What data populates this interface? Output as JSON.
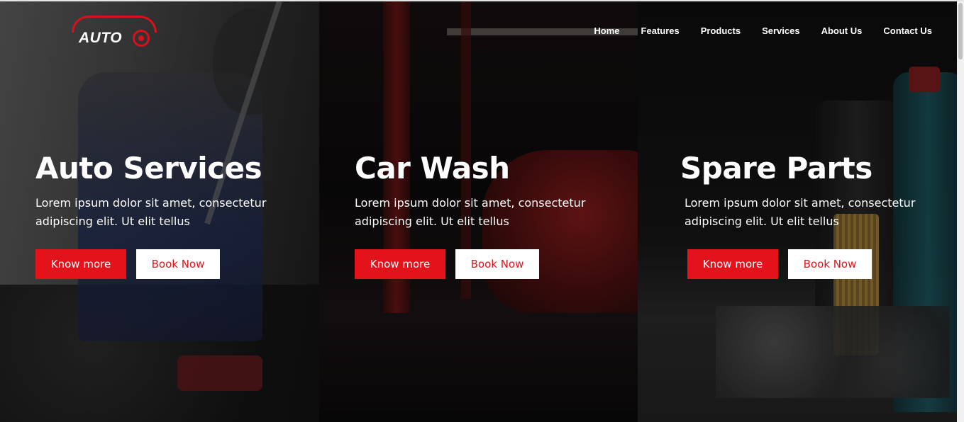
{
  "logo": {
    "text": "AUTO",
    "icon": "car-wheel-logo-icon",
    "accent": "#d8111a"
  },
  "nav": {
    "items": [
      {
        "label": "Home"
      },
      {
        "label": "Features"
      },
      {
        "label": "Products"
      },
      {
        "label": "Services"
      },
      {
        "label": "About Us"
      },
      {
        "label": "Contact Us"
      }
    ]
  },
  "panels": [
    {
      "title": "Auto Services",
      "description": "Lorem ipsum dolor sit amet, consectetur adipiscing elit. Ut elit tellus",
      "primary_button": "Know more",
      "secondary_button": "Book Now"
    },
    {
      "title": "Car Wash",
      "description": "Lorem ipsum dolor sit amet, consectetur adipiscing elit. Ut elit tellus",
      "primary_button": "Know more",
      "secondary_button": "Book Now"
    },
    {
      "title": "Spare Parts",
      "description": "Lorem ipsum dolor sit amet, consectetur adipiscing elit. Ut elit tellus",
      "primary_button": "Know more",
      "secondary_button": "Book Now"
    }
  ],
  "colors": {
    "accent": "#e3121b",
    "button_secondary_bg": "#ffffff",
    "text": "#ffffff"
  }
}
